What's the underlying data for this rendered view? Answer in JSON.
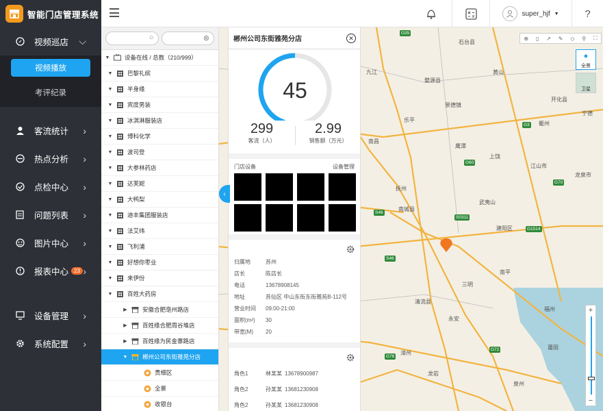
{
  "app": {
    "title": "智能门店管理系统",
    "logo_icon": "storefront-icon"
  },
  "sidebar": {
    "main": {
      "label": "视频巡店",
      "subitems": [
        "视频播放",
        "考评纪录"
      ]
    },
    "items": [
      {
        "label": "客流统计",
        "icon": "user-icon"
      },
      {
        "label": "热点分析",
        "icon": "heatmap-icon"
      },
      {
        "label": "点检中心",
        "icon": "check-icon"
      },
      {
        "label": "问题列表",
        "icon": "document-icon"
      },
      {
        "label": "图片中心",
        "icon": "image-icon"
      },
      {
        "label": "报表中心",
        "icon": "report-icon",
        "badge": "23"
      },
      {
        "label": "设备管理",
        "icon": "monitor-icon"
      },
      {
        "label": "系统配置",
        "icon": "gear-icon"
      }
    ]
  },
  "topbar": {
    "username": "super_hjf",
    "help": "?"
  },
  "tree": {
    "root": "设备在线 / 总数（210/999）",
    "items": [
      {
        "label": "巴黎礼缤",
        "level": 1,
        "icon": "building"
      },
      {
        "label": "半身缘",
        "level": 1,
        "icon": "building"
      },
      {
        "label": "宾度男装",
        "level": 1,
        "icon": "building"
      },
      {
        "label": "冰淇淋服装店",
        "level": 1,
        "icon": "building"
      },
      {
        "label": "博科化学",
        "level": 1,
        "icon": "building"
      },
      {
        "label": "波司登",
        "level": 1,
        "icon": "building"
      },
      {
        "label": "大参林药店",
        "level": 1,
        "icon": "building"
      },
      {
        "label": "达芙妮",
        "level": 1,
        "icon": "building"
      },
      {
        "label": "大鸭梨",
        "level": 1,
        "icon": "building"
      },
      {
        "label": "迪丰集团服装店",
        "level": 1,
        "icon": "building"
      },
      {
        "label": "法艾纬",
        "level": 1,
        "icon": "building"
      },
      {
        "label": "飞利浦",
        "level": 1,
        "icon": "building"
      },
      {
        "label": "好想你枣业",
        "level": 1,
        "icon": "building"
      },
      {
        "label": "来伊份",
        "level": 1,
        "icon": "building"
      },
      {
        "label": "百姓大药房",
        "level": 1,
        "icon": "building",
        "open": true
      },
      {
        "label": "安徽合肥亳州路店",
        "level": 2,
        "icon": "store"
      },
      {
        "label": "百姓缘合肥周谷堆店",
        "level": 2,
        "icon": "store"
      },
      {
        "label": "百姓缘为民金寨路店",
        "level": 2,
        "icon": "store"
      },
      {
        "label": "郴州公司东街雅苑分店",
        "level": 2,
        "icon": "store",
        "selected": true
      },
      {
        "label": "贵细区",
        "level": 3,
        "icon": "camera"
      },
      {
        "label": "全景",
        "level": 3,
        "icon": "camera"
      },
      {
        "label": "收银台",
        "level": 3,
        "icon": "camera"
      }
    ]
  },
  "panel": {
    "title": "郴州公司东街雅苑分店",
    "score": "45",
    "traffic_value": "299",
    "traffic_label": "客流（人）",
    "sales_value": "2.99",
    "sales_label": "销售额（万元）",
    "devices_label": "门店设备",
    "devices_manage": "设备管理",
    "info": [
      {
        "k": "归属地",
        "v": "苏州"
      },
      {
        "k": "店长",
        "v": "陈店长"
      },
      {
        "k": "电话",
        "v": "13678908145"
      },
      {
        "k": "地址",
        "v": "苏仙区 中山东街东街雅苑B-112号"
      },
      {
        "k": "营业时间",
        "v": "09:00-21:00"
      },
      {
        "k": "面积(m²)",
        "v": "30"
      },
      {
        "k": "带宽(M)",
        "v": "20"
      }
    ],
    "roles": [
      {
        "k": "角色1",
        "n": "林某某",
        "p": "13678900987"
      },
      {
        "k": "角色2",
        "n": "孙某某",
        "p": "13681230908"
      },
      {
        "k": "角色2",
        "n": "孙某某",
        "p": "13681230908"
      }
    ]
  },
  "map": {
    "type_labels": [
      "全景",
      "卫星"
    ],
    "places": [
      "石台县",
      "黄山",
      "婺源县",
      "九江",
      "开化县",
      "衢州",
      "景德镇",
      "南昌",
      "上饶",
      "江山市",
      "抚州",
      "南城县",
      "建阳区",
      "三明",
      "龙岩",
      "南平",
      "福州",
      "莆田",
      "泉州",
      "厦门",
      "漳州",
      "永安",
      "邵武市",
      "乐平",
      "鹰潭",
      "宁德",
      "铅山县",
      "武夷山",
      "金溪县",
      "清流县",
      "龙泉市",
      "庆元县",
      "汀州",
      "上杭"
    ],
    "roads": [
      "G35",
      "G60",
      "G3",
      "G1514",
      "G70",
      "G72",
      "G76",
      "G205",
      "S46",
      "G206",
      "S0311"
    ]
  }
}
